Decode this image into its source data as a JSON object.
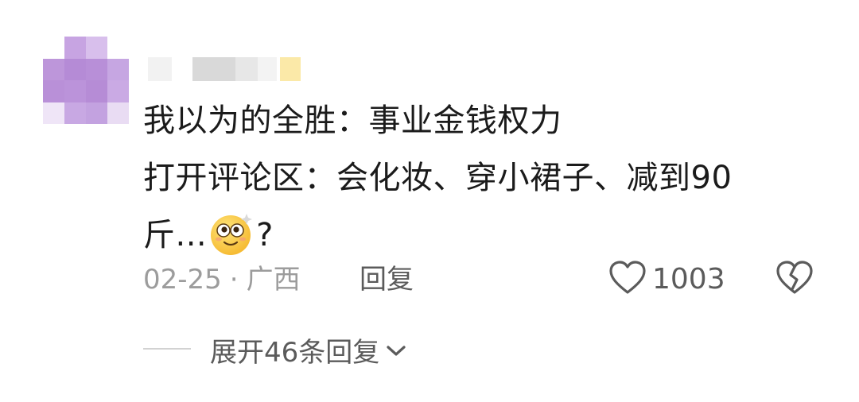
{
  "comment": {
    "lines": [
      "我以为的全胜：事业金钱权力",
      "打开评论区：会化妆、穿小裙子、减到90",
      "斤..."
    ],
    "trailing": "?",
    "emoji_name": "dizzy-eyes-emoji"
  },
  "meta": {
    "date": "02-25",
    "separator": "·",
    "location": "广西",
    "reply_label": "回复"
  },
  "actions": {
    "like_count": "1003",
    "like_icon": "heart-outline-icon",
    "dislike_icon": "broken-heart-icon"
  },
  "replies": {
    "expand_label": "展开46条回复",
    "expand_icon": "chevron-down-icon"
  },
  "colors": {
    "avatar_purple": "#b98ed8",
    "text_primary": "#1b1b1b",
    "text_secondary": "#9c9c9c",
    "text_action": "#5b5b5b"
  }
}
